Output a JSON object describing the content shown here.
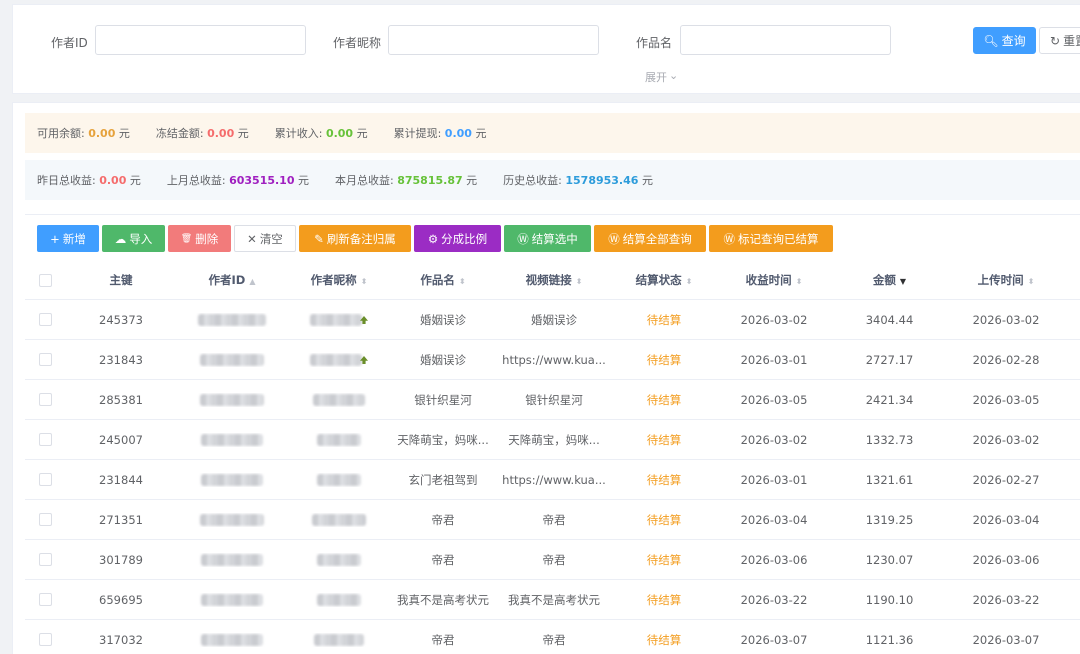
{
  "search": {
    "author_id_label": "作者ID",
    "nickname_label": "作者昵称",
    "work_name_label": "作品名",
    "query_label": "查询",
    "reset_label": "重置",
    "expand_label": "展开"
  },
  "stats1": {
    "available_label": "可用余额:",
    "available_value": "0.00",
    "frozen_label": "冻结金额:",
    "frozen_value": "0.00",
    "income_label": "累计收入:",
    "income_value": "0.00",
    "withdraw_label": "累计提现:",
    "withdraw_value": "0.00",
    "unit": "元"
  },
  "stats2": {
    "yesterday_label": "昨日总收益:",
    "yesterday_value": "0.00",
    "last_month_label": "上月总收益:",
    "last_month_value": "603515.10",
    "this_month_label": "本月总收益:",
    "this_month_value": "875815.87",
    "history_label": "历史总收益:",
    "history_value": "1578953.46",
    "unit": "元"
  },
  "toolbar": {
    "add": "新增",
    "import": "导入",
    "delete": "删除",
    "clear": "清空",
    "refresh_notes": "刷新备注归属",
    "split_ratio": "分成比例",
    "settle_selected": "结算选中",
    "settle_all": "结算全部查询",
    "mark_settled": "标记查询已结算"
  },
  "table": {
    "headers": [
      "主键",
      "作者ID",
      "作者昵称",
      "作品名",
      "视频链接",
      "结算状态",
      "收益时间",
      "金额",
      "上传时间"
    ],
    "rows": [
      {
        "id": "245373",
        "work": "婚姻误诊",
        "link": "婚姻误诊",
        "status": "待结算",
        "time": "2026-03-02",
        "amount": "3404.44",
        "upload": "2026-03-02"
      },
      {
        "id": "231843",
        "work": "婚姻误诊",
        "link": "https://www.kua...",
        "status": "待结算",
        "time": "2026-03-01",
        "amount": "2727.17",
        "upload": "2026-02-28"
      },
      {
        "id": "285381",
        "work": "银针织星河",
        "link": "银针织星河",
        "status": "待结算",
        "time": "2026-03-05",
        "amount": "2421.34",
        "upload": "2026-03-05"
      },
      {
        "id": "245007",
        "work": "天降萌宝，妈咪...",
        "link": "天降萌宝，妈咪...",
        "status": "待结算",
        "time": "2026-03-02",
        "amount": "1332.73",
        "upload": "2026-03-02"
      },
      {
        "id": "231844",
        "work": "玄门老祖驾到",
        "link": "https://www.kua...",
        "status": "待结算",
        "time": "2026-03-01",
        "amount": "1321.61",
        "upload": "2026-02-27"
      },
      {
        "id": "271351",
        "work": "帝君",
        "link": "帝君",
        "status": "待结算",
        "time": "2026-03-04",
        "amount": "1319.25",
        "upload": "2026-03-04"
      },
      {
        "id": "301789",
        "work": "帝君",
        "link": "帝君",
        "status": "待结算",
        "time": "2026-03-06",
        "amount": "1230.07",
        "upload": "2026-03-06"
      },
      {
        "id": "659695",
        "work": "我真不是高考状元",
        "link": "我真不是高考状元",
        "status": "待结算",
        "time": "2026-03-22",
        "amount": "1190.10",
        "upload": "2026-03-22"
      },
      {
        "id": "317032",
        "work": "帝君",
        "link": "帝君",
        "status": "待结算",
        "time": "2026-03-07",
        "amount": "1121.36",
        "upload": "2026-03-07"
      }
    ]
  }
}
